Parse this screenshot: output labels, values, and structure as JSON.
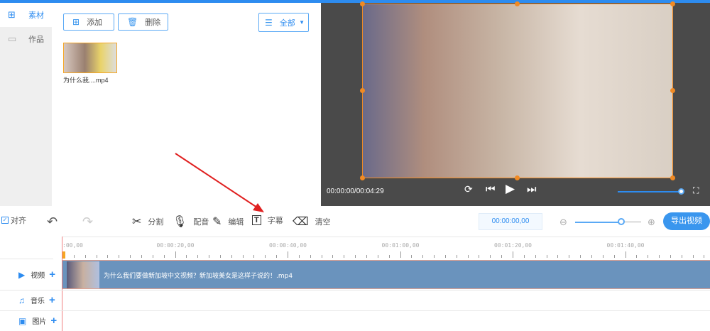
{
  "sidebar": {
    "items": [
      {
        "label": "素材",
        "icon": "grid-icon",
        "active": true
      },
      {
        "label": "作品",
        "icon": "folder-icon",
        "active": false
      }
    ]
  },
  "media": {
    "add_label": "添加",
    "delete_label": "删除",
    "filter_value": "全部",
    "items": [
      {
        "name": "为什么我....mp4"
      }
    ]
  },
  "player": {
    "time": "00:00:00/00:04:29",
    "volume": 1.0
  },
  "toolbar": {
    "align_label": "对齐",
    "align_checked": true,
    "split": "分割",
    "dub": "配音",
    "edit": "编辑",
    "subtitle": "字幕",
    "clear": "清空",
    "timecode": "00:00:00,00",
    "zoom_level": 0.75,
    "export": "导出视频"
  },
  "timeline": {
    "ruler": [
      ":00,00",
      "00:00:20,00",
      "00:00:40,00",
      "00:01:00,00",
      "00:01:20,00",
      "00:01:40,00"
    ],
    "tracks": [
      {
        "label": "视频",
        "icon": "video-icon"
      },
      {
        "label": "音乐",
        "icon": "music-icon"
      },
      {
        "label": "图片",
        "icon": "image-icon"
      }
    ],
    "clip": "为什么我们要做新加坡中文视频？新加坡美女是这样子说的！.mp4"
  },
  "colors": {
    "accent": "#2d8cf0",
    "clip": "#6a93bd",
    "selection": "#f08a24"
  }
}
